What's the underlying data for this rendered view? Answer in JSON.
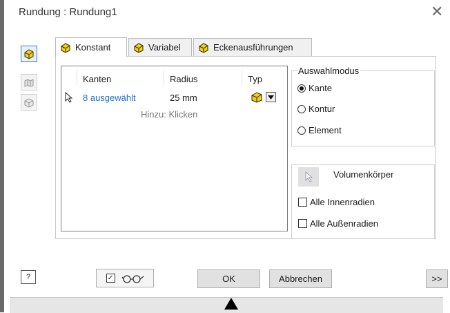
{
  "window": {
    "title": "Rundung : Rundung1"
  },
  "tabs": [
    {
      "label": "Konstant"
    },
    {
      "label": "Variabel"
    },
    {
      "label": "Eckenausführungen"
    }
  ],
  "table": {
    "headers": {
      "kanten": "Kanten",
      "radius": "Radius",
      "typ": "Typ"
    },
    "rows": [
      {
        "kanten": "8 ausgewählt",
        "radius": "25 mm"
      }
    ],
    "hint": "Hinzu: Klicken"
  },
  "auswahlmodus": {
    "label": "Auswahlmodus",
    "options": [
      "Kante",
      "Kontur",
      "Element"
    ],
    "selected": "Kante"
  },
  "volumen": {
    "label": "Volumenkörper",
    "checkbox1": "Alle Innenradien",
    "checkbox2": "Alle Außenradien"
  },
  "buttons": {
    "ok": "OK",
    "cancel": "Abbrechen",
    "more": ">>"
  },
  "colors": {
    "accent": "#3a78c8",
    "link": "#1f6fd0",
    "icon_yellow": "#f5d200"
  }
}
